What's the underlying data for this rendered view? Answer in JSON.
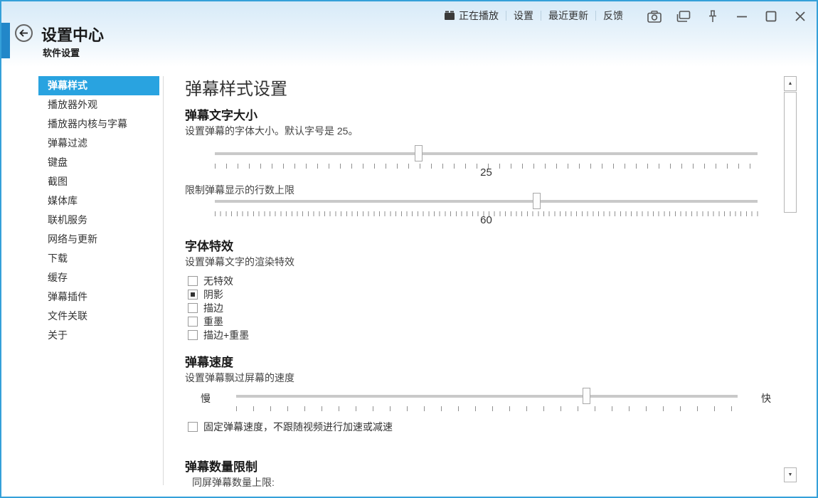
{
  "accent_color": "#29a3e0",
  "border_color": "#35a0d9",
  "window": {
    "title": "设置中心",
    "subtitle": "软件设置",
    "menu": [
      {
        "label": "正在播放",
        "icon": "now-playing-icon"
      },
      {
        "label": "设置"
      },
      {
        "label": "最近更新"
      },
      {
        "label": "反馈"
      }
    ],
    "window_icons": [
      "camera-icon",
      "cascade-windows-icon",
      "pin-icon",
      "minimize-icon",
      "maximize-icon",
      "close-icon"
    ]
  },
  "sidebar": {
    "selected": "弹幕样式",
    "items": [
      {
        "label": "弹幕样式",
        "selected": true
      },
      {
        "label": "播放器外观",
        "selected": false
      },
      {
        "label": "播放器内核与字幕",
        "selected": false
      },
      {
        "label": "弹幕过滤",
        "selected": false
      },
      {
        "label": "键盘",
        "selected": false
      },
      {
        "label": "截图",
        "selected": false
      },
      {
        "label": "媒体库",
        "selected": false
      },
      {
        "label": "联机服务",
        "selected": false
      },
      {
        "label": "网络与更新",
        "selected": false
      },
      {
        "label": "下载",
        "selected": false
      },
      {
        "label": "缓存",
        "selected": false
      },
      {
        "label": "弹幕插件",
        "selected": false
      },
      {
        "label": "文件关联",
        "selected": false
      },
      {
        "label": "关于",
        "selected": false
      }
    ]
  },
  "main": {
    "page_title": "弹幕样式设置",
    "font_size_section": {
      "heading": "弹幕文字大小",
      "desc": "设置弹幕的字体大小。默认字号是 25。",
      "size_value": "25",
      "row_limit_label": "限制弹幕显示的行数上限",
      "row_limit_value": "60"
    },
    "font_effects_section": {
      "heading": "字体特效",
      "desc": "设置弹幕文字的渲染特效",
      "options": [
        {
          "label": "无特效",
          "checked": false
        },
        {
          "label": "阴影",
          "checked": true
        },
        {
          "label": "描边",
          "checked": false
        },
        {
          "label": "重墨",
          "checked": false
        },
        {
          "label": "描边+重墨",
          "checked": false
        }
      ]
    },
    "speed_section": {
      "heading": "弹幕速度",
      "desc": "设置弹幕飘过屏幕的速度",
      "slow_label": "慢",
      "fast_label": "快",
      "fixed_speed": {
        "label": "固定弹幕速度，不跟随视频进行加速或减速",
        "checked": false
      }
    },
    "count_limit_section": {
      "heading": "弹幕数量限制",
      "partial_label": "同屏弹幕数量上限:"
    }
  }
}
